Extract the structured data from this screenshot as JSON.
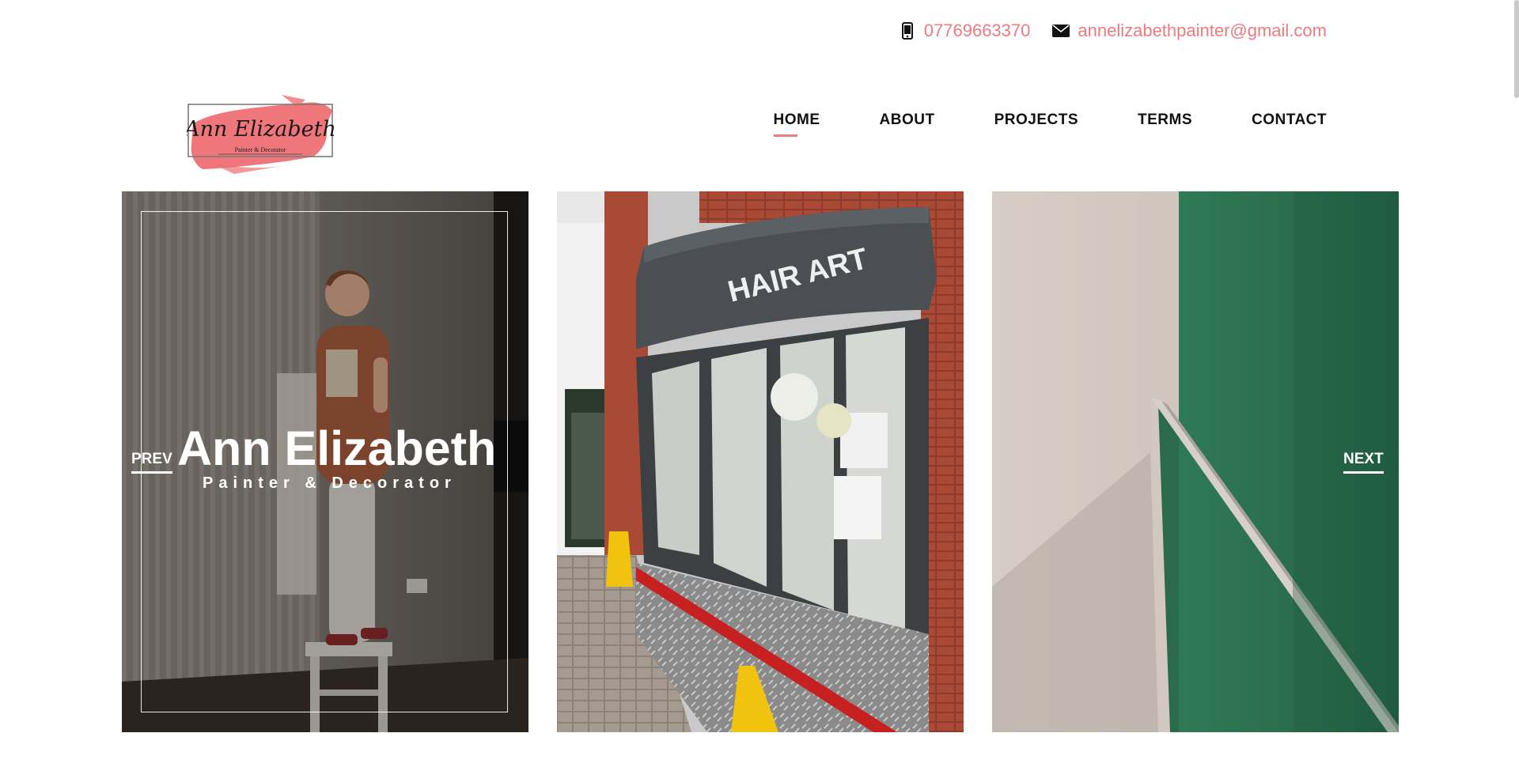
{
  "contact": {
    "phone": "07769663370",
    "email": "annelizabethpainter@gmail.com",
    "phone_icon": "mobile-phone-icon",
    "email_icon": "envelope-icon"
  },
  "logo": {
    "name": "Ann Elizabeth",
    "tagline": "Painter & Decorator"
  },
  "nav": {
    "items": [
      {
        "label": "HOME",
        "active": true
      },
      {
        "label": "ABOUT",
        "active": false
      },
      {
        "label": "PROJECTS",
        "active": false
      },
      {
        "label": "TERMS",
        "active": false
      },
      {
        "label": "CONTACT",
        "active": false
      }
    ]
  },
  "slider": {
    "title": "Ann Elizabeth",
    "subtitle": "Painter & Decorator",
    "prev_label": "PREV",
    "next_label": "NEXT"
  },
  "colors": {
    "accent": "#ec7b7f",
    "text": "#111111",
    "background": "#ffffff"
  }
}
